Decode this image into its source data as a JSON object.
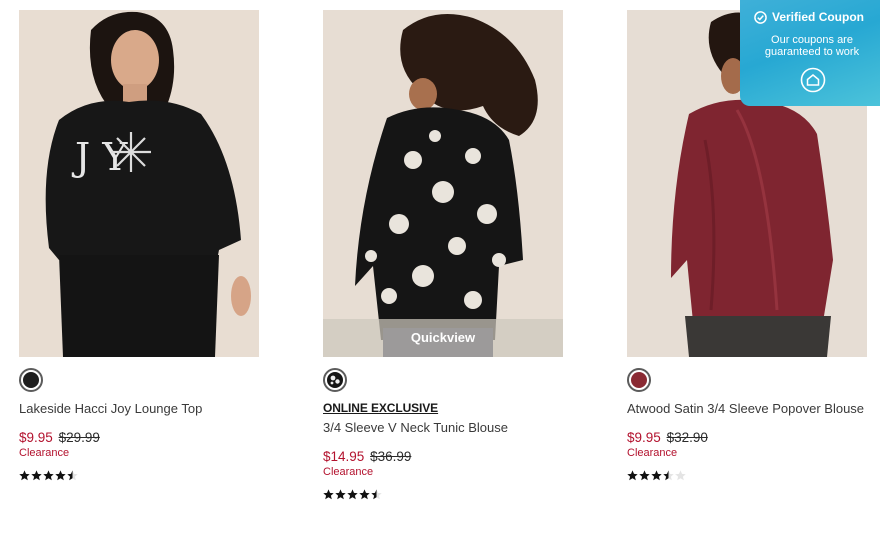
{
  "products": [
    {
      "name": "Lakeside Hacci Joy Lounge Top",
      "badge": "",
      "swatch_color": "#1f1f1f",
      "price_sale": "$9.95",
      "price_original": "$29.99",
      "tag": "Clearance",
      "rating": 4.5,
      "stars_shown": 5,
      "photo_text": "J    Y"
    },
    {
      "name": "3/4 Sleeve V Neck Tunic Blouse",
      "badge": "ONLINE EXCLUSIVE",
      "swatch_color": "#1a1a1a",
      "price_sale": "$14.95",
      "price_original": "$36.99",
      "tag": "Clearance",
      "rating": 4.5,
      "stars_shown": 5,
      "quickview": "Quickview"
    },
    {
      "name": "Atwood Satin 3/4 Sleeve Popover Blouse",
      "badge": "",
      "swatch_color": "#8a2a33",
      "price_sale": "$9.95",
      "price_original": "$32.90",
      "tag": "Clearance",
      "rating": 3.5,
      "stars_shown": 5
    }
  ],
  "coupon": {
    "title": "Verified Coupon",
    "subtitle": "Our coupons are guaranteed to work",
    "icons": [
      "check-badge-icon",
      "home-icon"
    ]
  },
  "colors": {
    "sale_red": "#b3122e",
    "coupon_blue": "#27a8d3"
  }
}
